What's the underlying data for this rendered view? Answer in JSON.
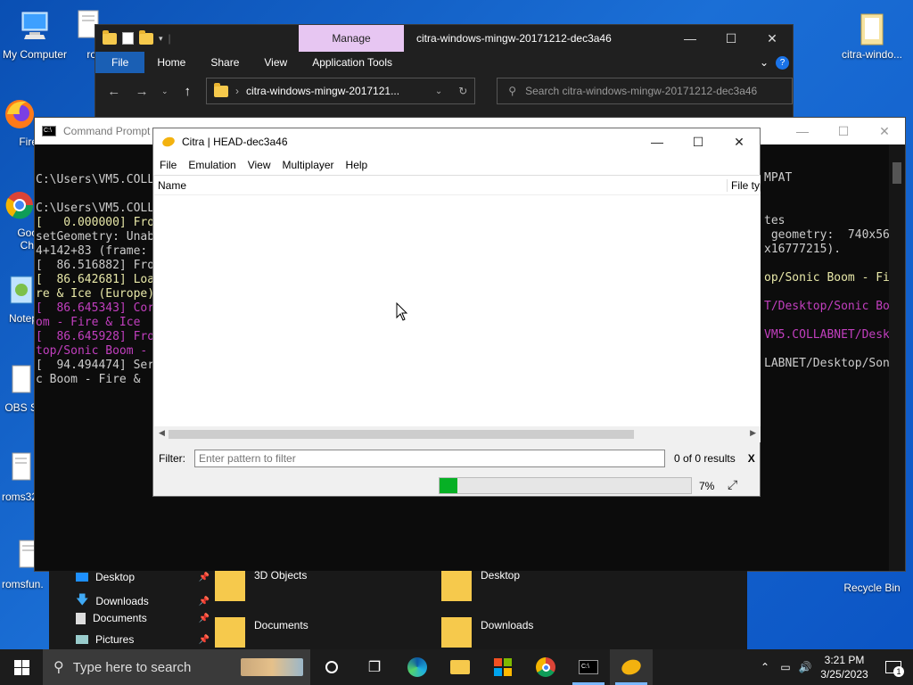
{
  "desktop": {
    "icons_left": [
      {
        "label": "My Computer",
        "icon": "computer-icon"
      },
      {
        "label": "Fire",
        "icon": "firefox-icon"
      },
      {
        "label": "Goo Chr",
        "icon": "chrome-icon"
      },
      {
        "label": "Notep",
        "icon": "notepad-icon"
      },
      {
        "label": "OBS S",
        "icon": "obs-icon"
      },
      {
        "label": "roms32",
        "icon": "file-icon"
      },
      {
        "label": "romsfun.",
        "icon": "file-icon"
      }
    ],
    "icon_rom_partial": "rom",
    "icon_right_top": "citra-windo...",
    "icon_recycle": "Recycle Bin"
  },
  "explorer": {
    "manage_tab": "Manage",
    "title": "citra-windows-mingw-20171212-dec3a46",
    "ribbon_tabs": [
      "File",
      "Home",
      "Share",
      "View",
      "Application Tools"
    ],
    "address": "citra-windows-mingw-2017121...",
    "search_placeholder": "Search citra-windows-mingw-20171212-dec3a46"
  },
  "cmd": {
    "title": "Command Prompt",
    "lines_left": [
      "C:\\Users\\VM5.COLL",
      "",
      "C:\\Users\\VM5.COLL",
      "[   0.000000] Fro",
      "setGeometry: Unab",
      "4+142+83 (frame:",
      "[  86.516882] Fro",
      "[  86.642681] Loa",
      "re & Ice (Europe)",
      "[  86.645343] Cor",
      "om - Fire & Ice",
      "[  86.645928] Fro",
      "top/Sonic Boom -",
      "[  94.494474] Ser",
      "c Boom - Fire &"
    ],
    "lines_right": [
      "MPAT",
      "",
      "",
      "tes",
      " geometry:  740x56",
      "x16777215).",
      "",
      "op/Sonic Boom - Fi",
      "",
      "T/Desktop/Sonic Bo",
      "",
      "VM5.COLLABNET/Desk",
      "",
      "LABNET/Desktop/Son"
    ]
  },
  "nav_pane": {
    "items": [
      "Desktop",
      "Downloads",
      "Documents",
      "Pictures"
    ],
    "folders": [
      "3D Objects",
      "Desktop",
      "Documents",
      "Downloads"
    ]
  },
  "citra": {
    "title": "Citra | HEAD-dec3a46",
    "menu": [
      "File",
      "Emulation",
      "View",
      "Multiplayer",
      "Help"
    ],
    "columns": {
      "name": "Name",
      "file_type": "File typ"
    },
    "filter_label": "Filter:",
    "filter_placeholder": "Enter pattern to filter",
    "results": "0 of 0 results",
    "clear": "X",
    "progress_percent": 7,
    "progress_label": "7%"
  },
  "taskbar": {
    "search_placeholder": "Type here to search",
    "time": "3:21 PM",
    "date": "3/25/2023",
    "notification_count": "1"
  }
}
